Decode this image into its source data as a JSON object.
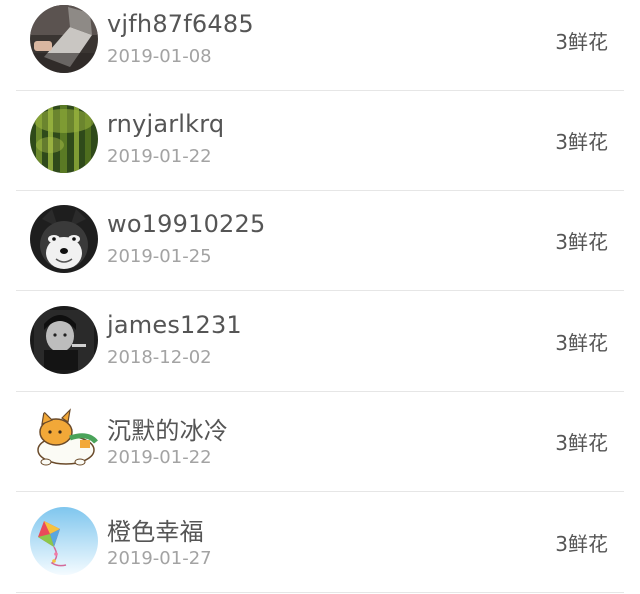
{
  "users": [
    {
      "name": "vjfh87f6485",
      "date": "2019-01-08",
      "gift": "3鲜花",
      "avatar_icon": "laptop-photo-avatar"
    },
    {
      "name": "rnyjarlkrq",
      "date": "2019-01-22",
      "gift": "3鲜花",
      "avatar_icon": "bamboo-photo-avatar"
    },
    {
      "name": "wo19910225",
      "date": "2019-01-25",
      "gift": "3鲜花",
      "avatar_icon": "husky-dog-avatar"
    },
    {
      "name": "james1231",
      "date": "2018-12-02",
      "gift": "3鲜花",
      "avatar_icon": "bw-portrait-avatar"
    },
    {
      "name": "沉默的冰冷",
      "date": "2019-01-22",
      "gift": "3鲜花",
      "avatar_icon": "cartoon-cat-avatar"
    },
    {
      "name": "橙色幸福",
      "date": "2019-01-27",
      "gift": "3鲜花",
      "avatar_icon": "kite-sky-avatar"
    }
  ]
}
